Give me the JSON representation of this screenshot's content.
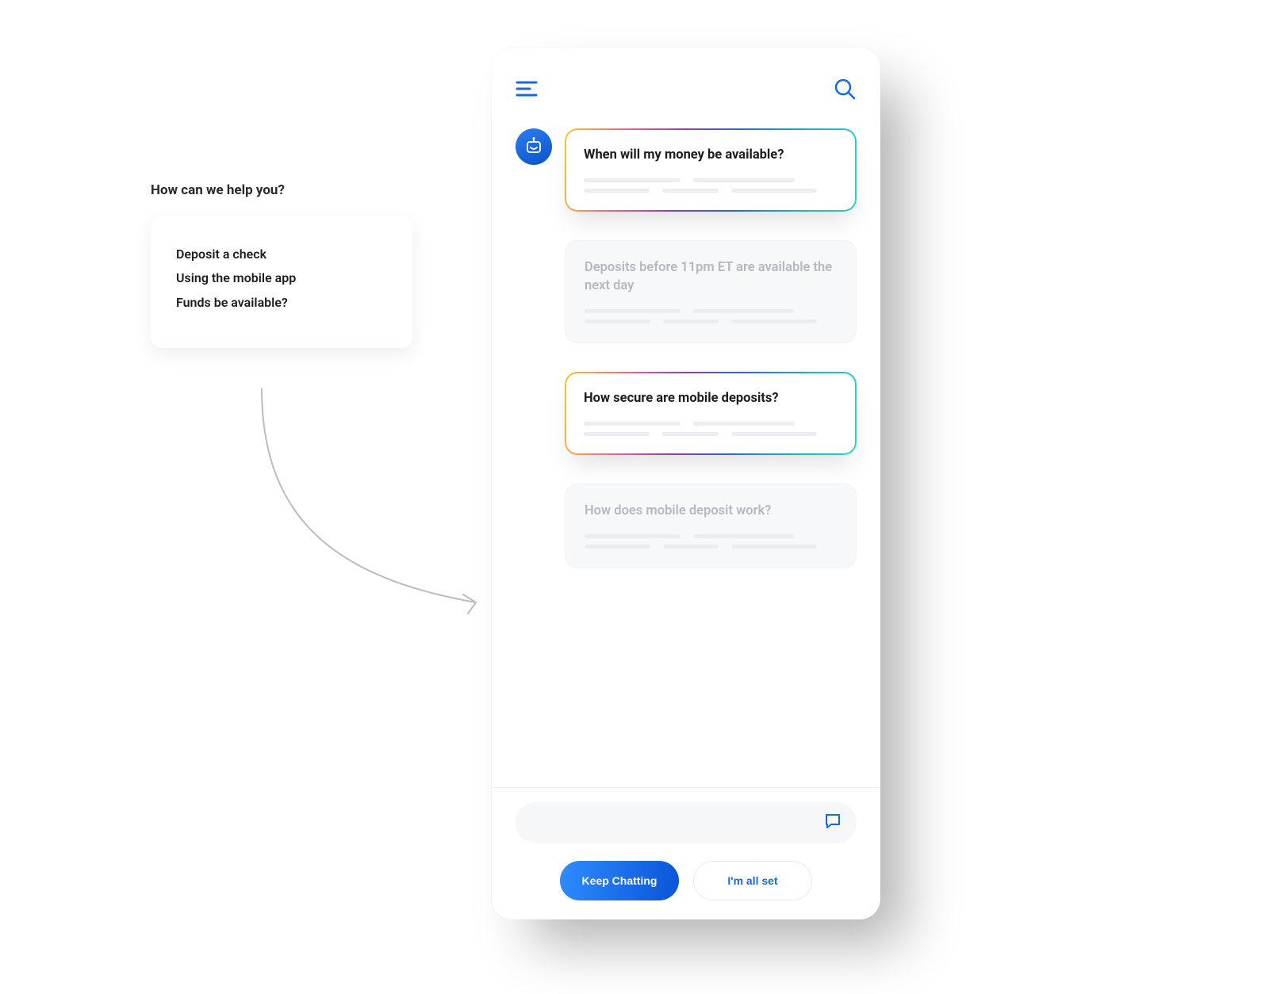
{
  "help": {
    "title": "How can we help you?",
    "lines": [
      "Deposit a check",
      "Using the mobile app",
      "Funds be available?"
    ]
  },
  "chat": {
    "cards": [
      {
        "text": "When will my money be available?"
      },
      {
        "text": "Deposits before 11pm ET are available the next day"
      },
      {
        "text": "How secure are mobile deposits?"
      },
      {
        "text": "How does mobile deposit work?"
      }
    ]
  },
  "actions": {
    "keep": "Keep Chatting",
    "done": "I'm all set"
  },
  "icons": {
    "menu": "menu-icon",
    "search": "search-icon",
    "bot": "bot-avatar-icon",
    "send": "chat-icon"
  }
}
